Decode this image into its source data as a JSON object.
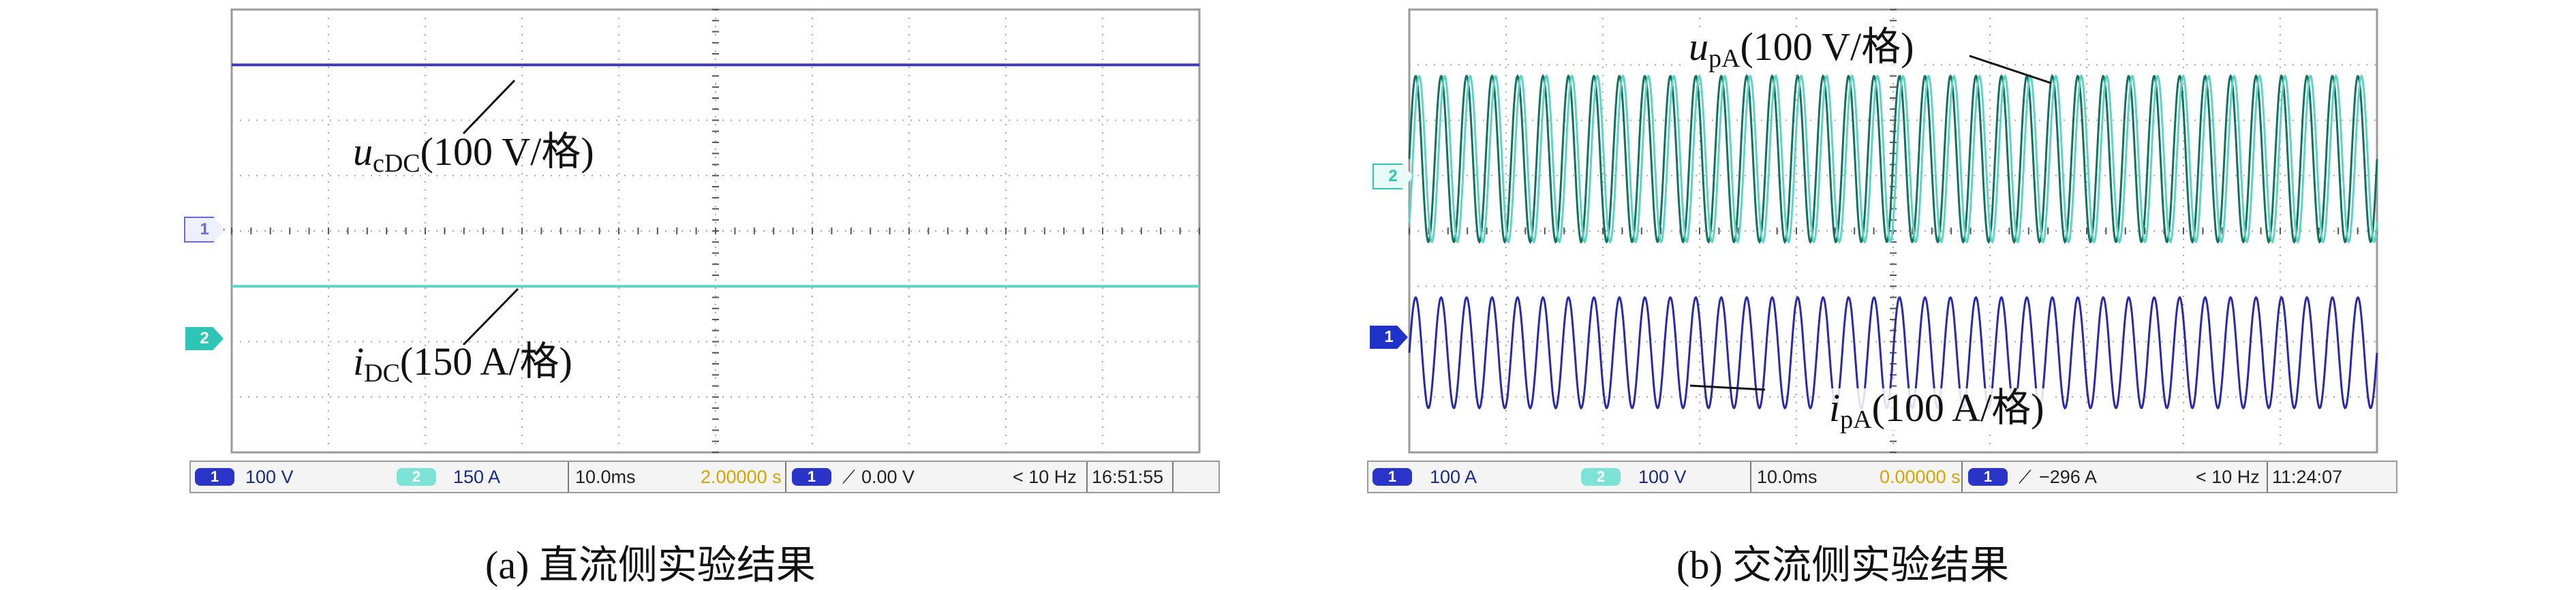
{
  "colors": {
    "blue_trace": "#3a3ab8",
    "cyan_trace": "#5fd3c4",
    "dark_green_trace": "#14705f",
    "grid": "#a8a8a8",
    "status_text": "#1a2a88"
  },
  "panels": [
    {
      "caption": "(a) 直流侧实验结果",
      "annotations": [
        {
          "var": "u",
          "sub": "cDC",
          "text": "(100 V/格)"
        },
        {
          "var": "i",
          "sub": "DC",
          "text": "(150 A/格)"
        }
      ],
      "markers": [
        {
          "label": "1",
          "color": "#6b6bd8"
        },
        {
          "label": "2",
          "color": "#2ec4b6"
        }
      ],
      "status": {
        "ch1": "100 V",
        "ch2": "150 A",
        "timebase": "10.0ms",
        "offset": "2.00000 s",
        "trig_ch": "1",
        "trig_icon": "rising-edge-icon",
        "trig_level": "0.00 V",
        "freq": "< 10 Hz",
        "clock": "16:51:55"
      }
    },
    {
      "caption": "(b) 交流侧实验结果",
      "annotations": [
        {
          "var": "u",
          "sub": "pA",
          "text": "(100 V/格)"
        },
        {
          "var": "i",
          "sub": "pA",
          "text": "(100 A/格)"
        }
      ],
      "markers": [
        {
          "label": "2",
          "color": "#2ec4b6"
        },
        {
          "label": "1",
          "color": "#1f33c8"
        }
      ],
      "status": {
        "ch1": "100 A",
        "ch2": "100 V",
        "timebase": "10.0ms",
        "offset": "0.00000 s",
        "trig_ch": "1",
        "trig_icon": "rising-edge-icon",
        "trig_level": "−296 A",
        "freq": "< 10 Hz",
        "clock": "11:24:07"
      }
    }
  ],
  "chart_data": [
    {
      "type": "line",
      "grid": true,
      "x": {
        "unit": "ms",
        "divisions": 10,
        "per_div": 10.0
      },
      "y": {
        "divisions": 8
      },
      "series": [
        {
          "shape": "constant",
          "level_div": 3.0,
          "color": "#3a3ab8"
        },
        {
          "shape": "constant",
          "level_div": -1.0,
          "color": "#5fd3c4"
        }
      ]
    },
    {
      "type": "line",
      "grid": true,
      "x": {
        "unit": "ms",
        "divisions": 10,
        "per_div": 10.0
      },
      "y": {
        "divisions": 8
      },
      "series": [
        {
          "shape": "sine",
          "cycles": 38,
          "amplitude_div": 1.5,
          "offset_div": 1.3,
          "color": "#14705f"
        },
        {
          "shape": "sine",
          "cycles": 38,
          "amplitude_div": 1.5,
          "offset_div": 1.3,
          "phase_deg": -50,
          "color": "#5fd3c4"
        },
        {
          "shape": "sine",
          "cycles": 38,
          "amplitude_div": 1.0,
          "offset_div": -2.2,
          "color": "#2a2aa8"
        }
      ]
    }
  ]
}
